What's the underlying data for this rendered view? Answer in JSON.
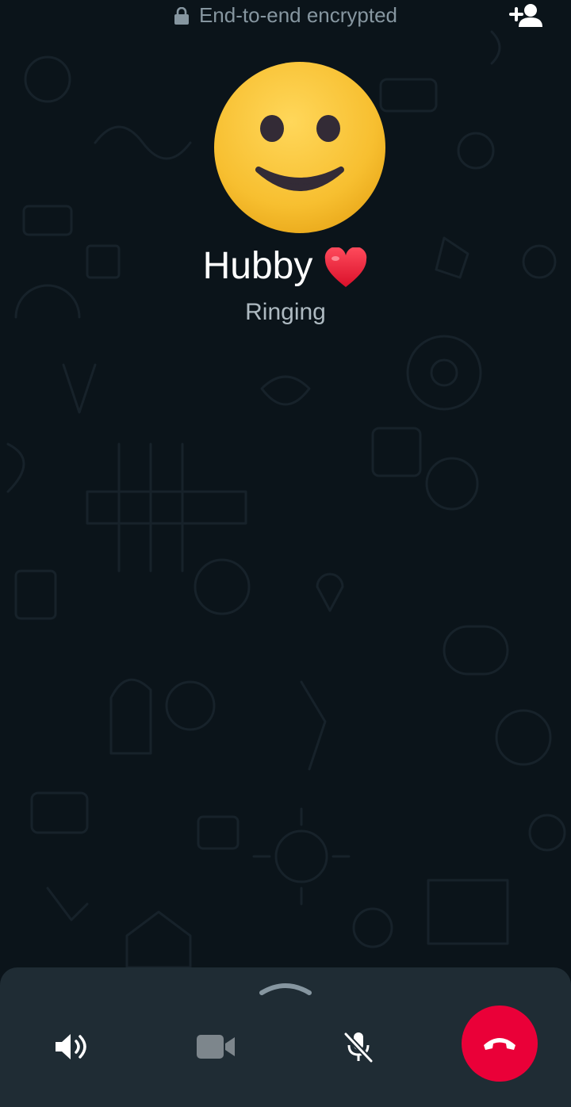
{
  "header": {
    "encryption_text": "End-to-end encrypted",
    "lock_icon": "lock-icon",
    "add_participant_icon": "add-person-icon"
  },
  "contact": {
    "name": "Hubby",
    "name_emoji": "heart-emoji",
    "avatar": "smiling-face-emoji",
    "status": "Ringing"
  },
  "controls": {
    "expand_icon": "chevron-up-icon",
    "speaker_icon": "speaker-icon",
    "video_icon": "video-camera-off-icon",
    "mute_icon": "microphone-off-icon",
    "end_call_icon": "end-call-icon"
  },
  "colors": {
    "background": "#0b141a",
    "sheet": "#1f2c34",
    "end_call": "#ea0038",
    "secondary_text": "#8696a0"
  }
}
